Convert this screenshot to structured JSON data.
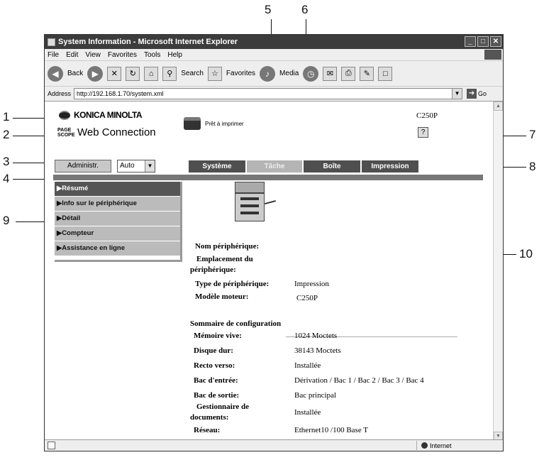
{
  "callouts": [
    "1",
    "2",
    "3",
    "4",
    "5",
    "6",
    "7",
    "8",
    "9",
    "10"
  ],
  "window": {
    "title": "System Information - Microsoft Internet Explorer",
    "buttons": {
      "minimize": "_",
      "maximize": "□",
      "close": "✕"
    }
  },
  "menu": [
    "File",
    "Edit",
    "View",
    "Favorites",
    "Tools",
    "Help"
  ],
  "toolbar": {
    "back": "Back",
    "search": "Search",
    "favorites": "Favorites",
    "media": "Media"
  },
  "address": {
    "label": "Address",
    "url": "http://192.168.1.70/system.xml",
    "go": "Go"
  },
  "header": {
    "brand": "KONICA MINOLTA",
    "product_small": "PAGE SCOPE",
    "product": "Web Connection",
    "status": "Prêt à imprimer",
    "model": "C250P",
    "help": "?"
  },
  "controls": {
    "admin": "Administr.",
    "mode": "Auto"
  },
  "tabs": [
    "Système",
    "Tâche",
    "Boîte",
    "Impression"
  ],
  "sidebar": [
    "▶Résumé",
    "▶Info sur le périphérique",
    "▶Détail",
    "▶Compteur",
    "▶Assistance en ligne"
  ],
  "device": {
    "name_label": "Nom périphérique:",
    "location_label_1": "Emplacement du",
    "location_label_2": "périphérique:",
    "type_label": "Type de périphérique:",
    "type_value": "Impression",
    "engine_label": "Modèle moteur:",
    "engine_value": "C250P"
  },
  "config": {
    "title": "Sommaire de configuration",
    "rows": [
      {
        "label": "Mémoire vive:",
        "value": "1024 Moctets"
      },
      {
        "label": "Disque dur:",
        "value": "38143 Moctets"
      },
      {
        "label": "Recto verso:",
        "value": "Installée"
      },
      {
        "label": "Bac d'entrée:",
        "value": "Dérivation / Bac 1 / Bac 2 / Bac 3 / Bac 4"
      },
      {
        "label": "Bac de sortie:",
        "value": "Bac principal"
      },
      {
        "label_1": "Gestionnaire de",
        "label_2": "documents:",
        "value": "Installée"
      },
      {
        "label": "Réseau:",
        "value": "Ethernet10 /100 Base T"
      }
    ]
  },
  "statusbar": {
    "zone": "Internet"
  }
}
